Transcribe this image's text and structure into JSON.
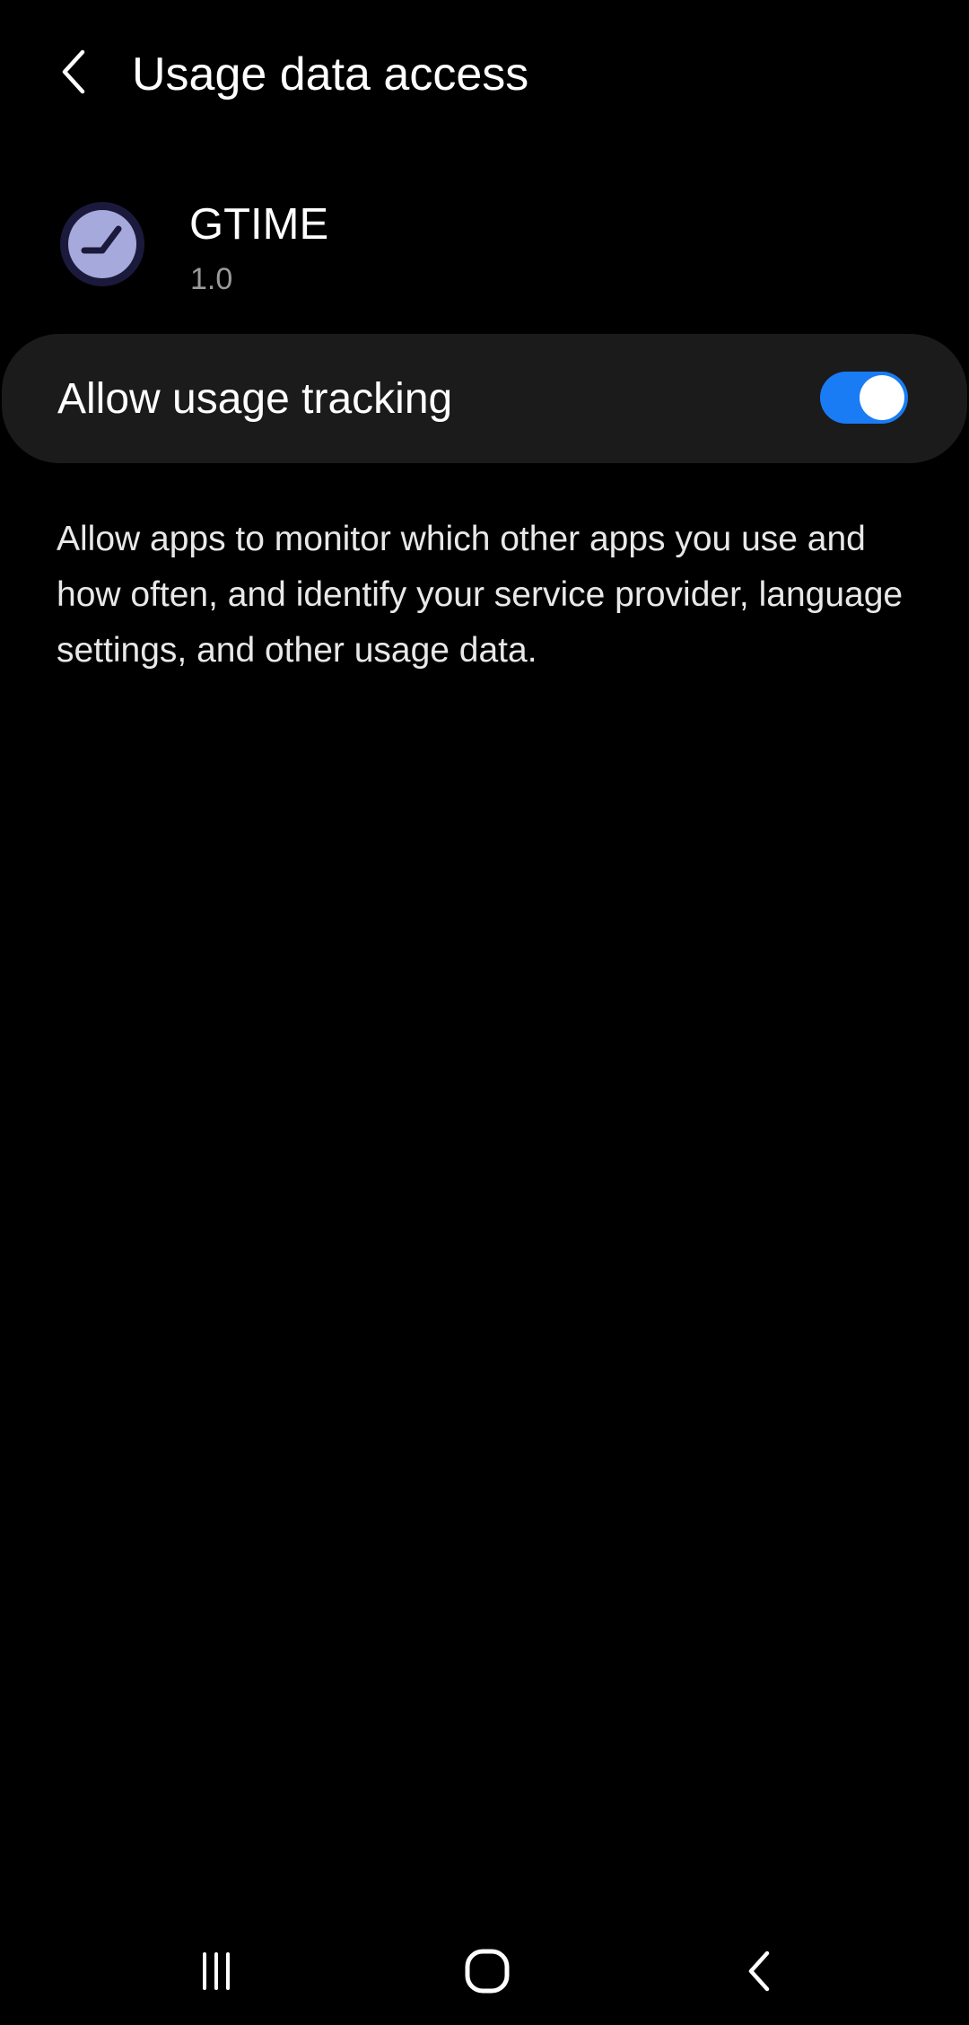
{
  "header": {
    "title": "Usage data access",
    "back_icon": "chevron-left-icon"
  },
  "app": {
    "name": "GTIME",
    "version": "1.0",
    "icon": "clock-icon",
    "icon_colors": {
      "face": "#a6a9dc",
      "rim": "#1c1a3c",
      "hands": "#1c1a3c"
    }
  },
  "toggle": {
    "label": "Allow usage tracking",
    "state": "on",
    "colors": {
      "track": "#1a7cf5",
      "knob": "#ffffff",
      "card": "#1b1b1b"
    }
  },
  "description": "Allow apps to monitor which other apps you use and how often, and identify your service provider, language settings, and other usage data.",
  "nav_bar": {
    "recents_icon": "recents-icon",
    "home_icon": "home-icon",
    "back_icon": "back-icon"
  }
}
